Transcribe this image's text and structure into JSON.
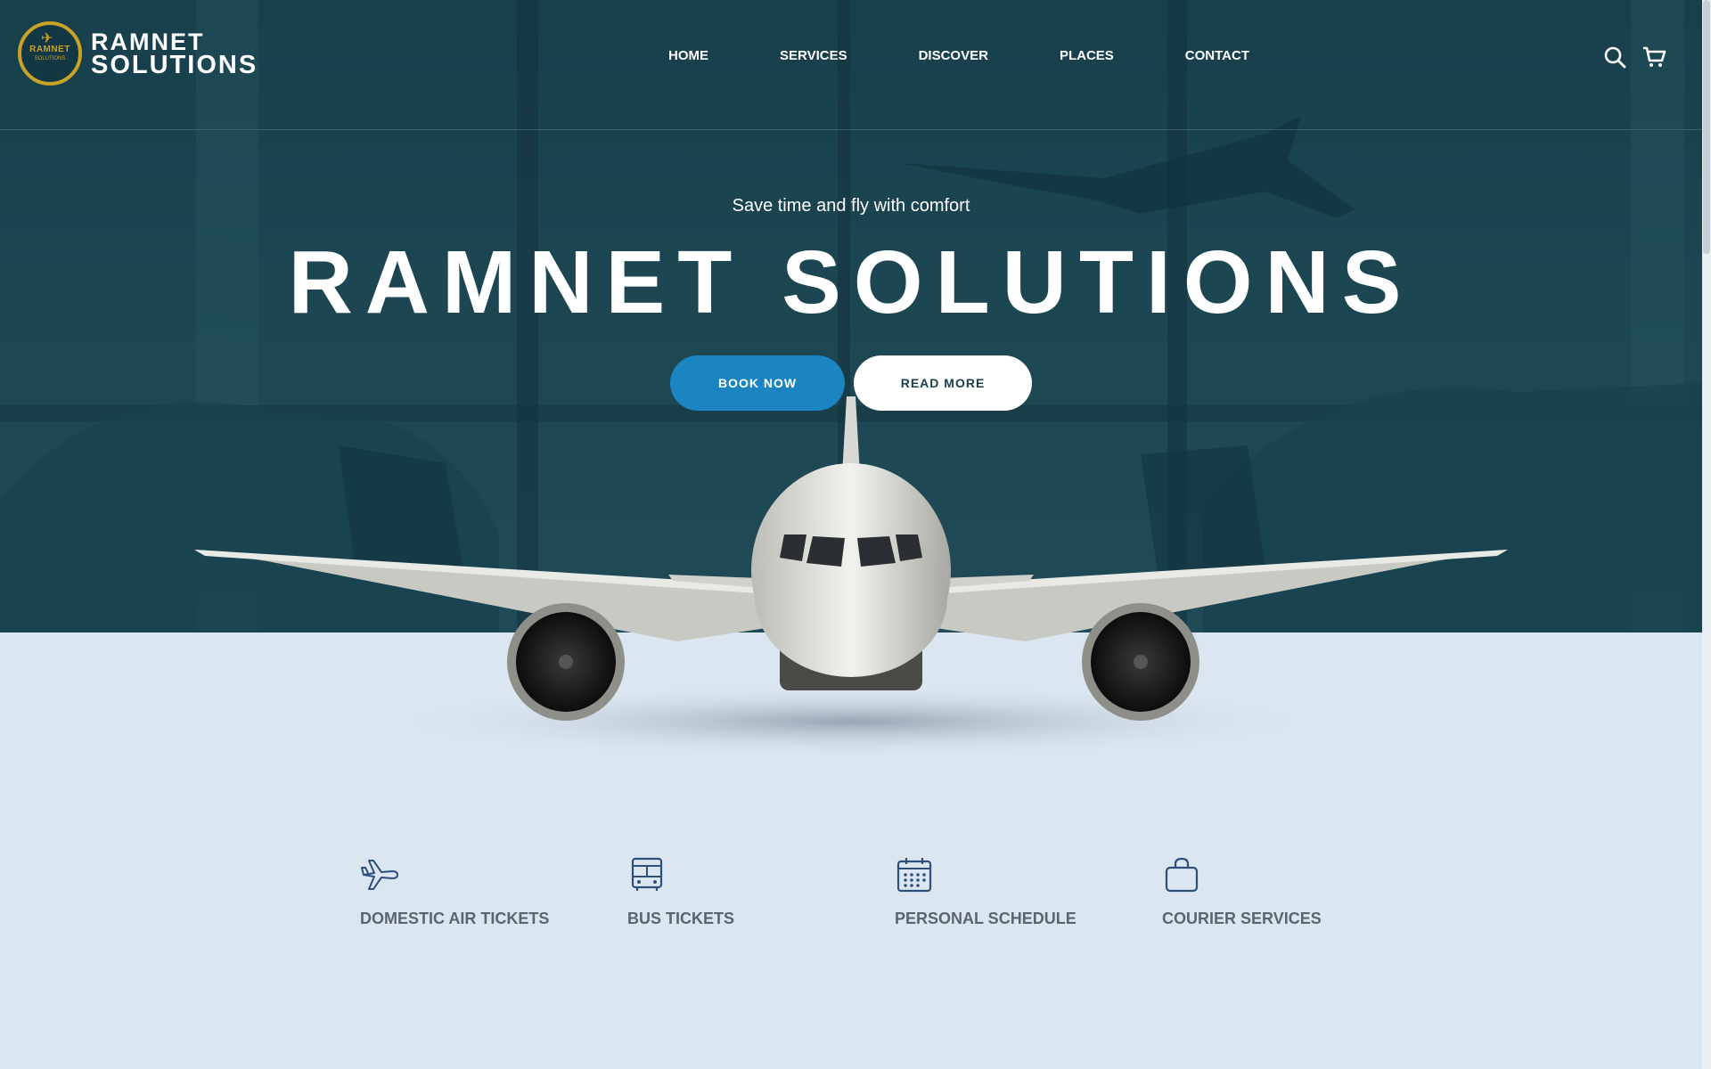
{
  "brand": {
    "name_line1": "RAMNET",
    "name_line2": "SOLUTIONS",
    "badge_text": "RAMNET",
    "badge_sub": "SOLUTIONS"
  },
  "nav": {
    "items": [
      {
        "label": "HOME"
      },
      {
        "label": "SERVICES"
      },
      {
        "label": "DISCOVER"
      },
      {
        "label": "PLACES"
      },
      {
        "label": "CONTACT"
      }
    ]
  },
  "header_icons": [
    "search-icon",
    "cart-icon"
  ],
  "hero": {
    "tagline": "Save time and fly with comfort",
    "title": "RAMNET SOLUTIONS",
    "book_label": "BOOK NOW",
    "read_label": "READ MORE"
  },
  "services": [
    {
      "icon": "airplane-icon",
      "label": "DOMESTIC AIR TICKETS"
    },
    {
      "icon": "bus-icon",
      "label": "BUS TICKETS"
    },
    {
      "icon": "calendar-icon",
      "label": "PERSONAL SCHEDULE"
    },
    {
      "icon": "bag-icon",
      "label": "COURIER SERVICES"
    }
  ],
  "colors": {
    "hero_bg": "#1b4652",
    "accent_blue": "#1b85c2",
    "logo_gold": "#c9a227",
    "page_bg": "#dce6f1",
    "service_icon": "#2d4f7a",
    "service_text": "#5b6570"
  }
}
